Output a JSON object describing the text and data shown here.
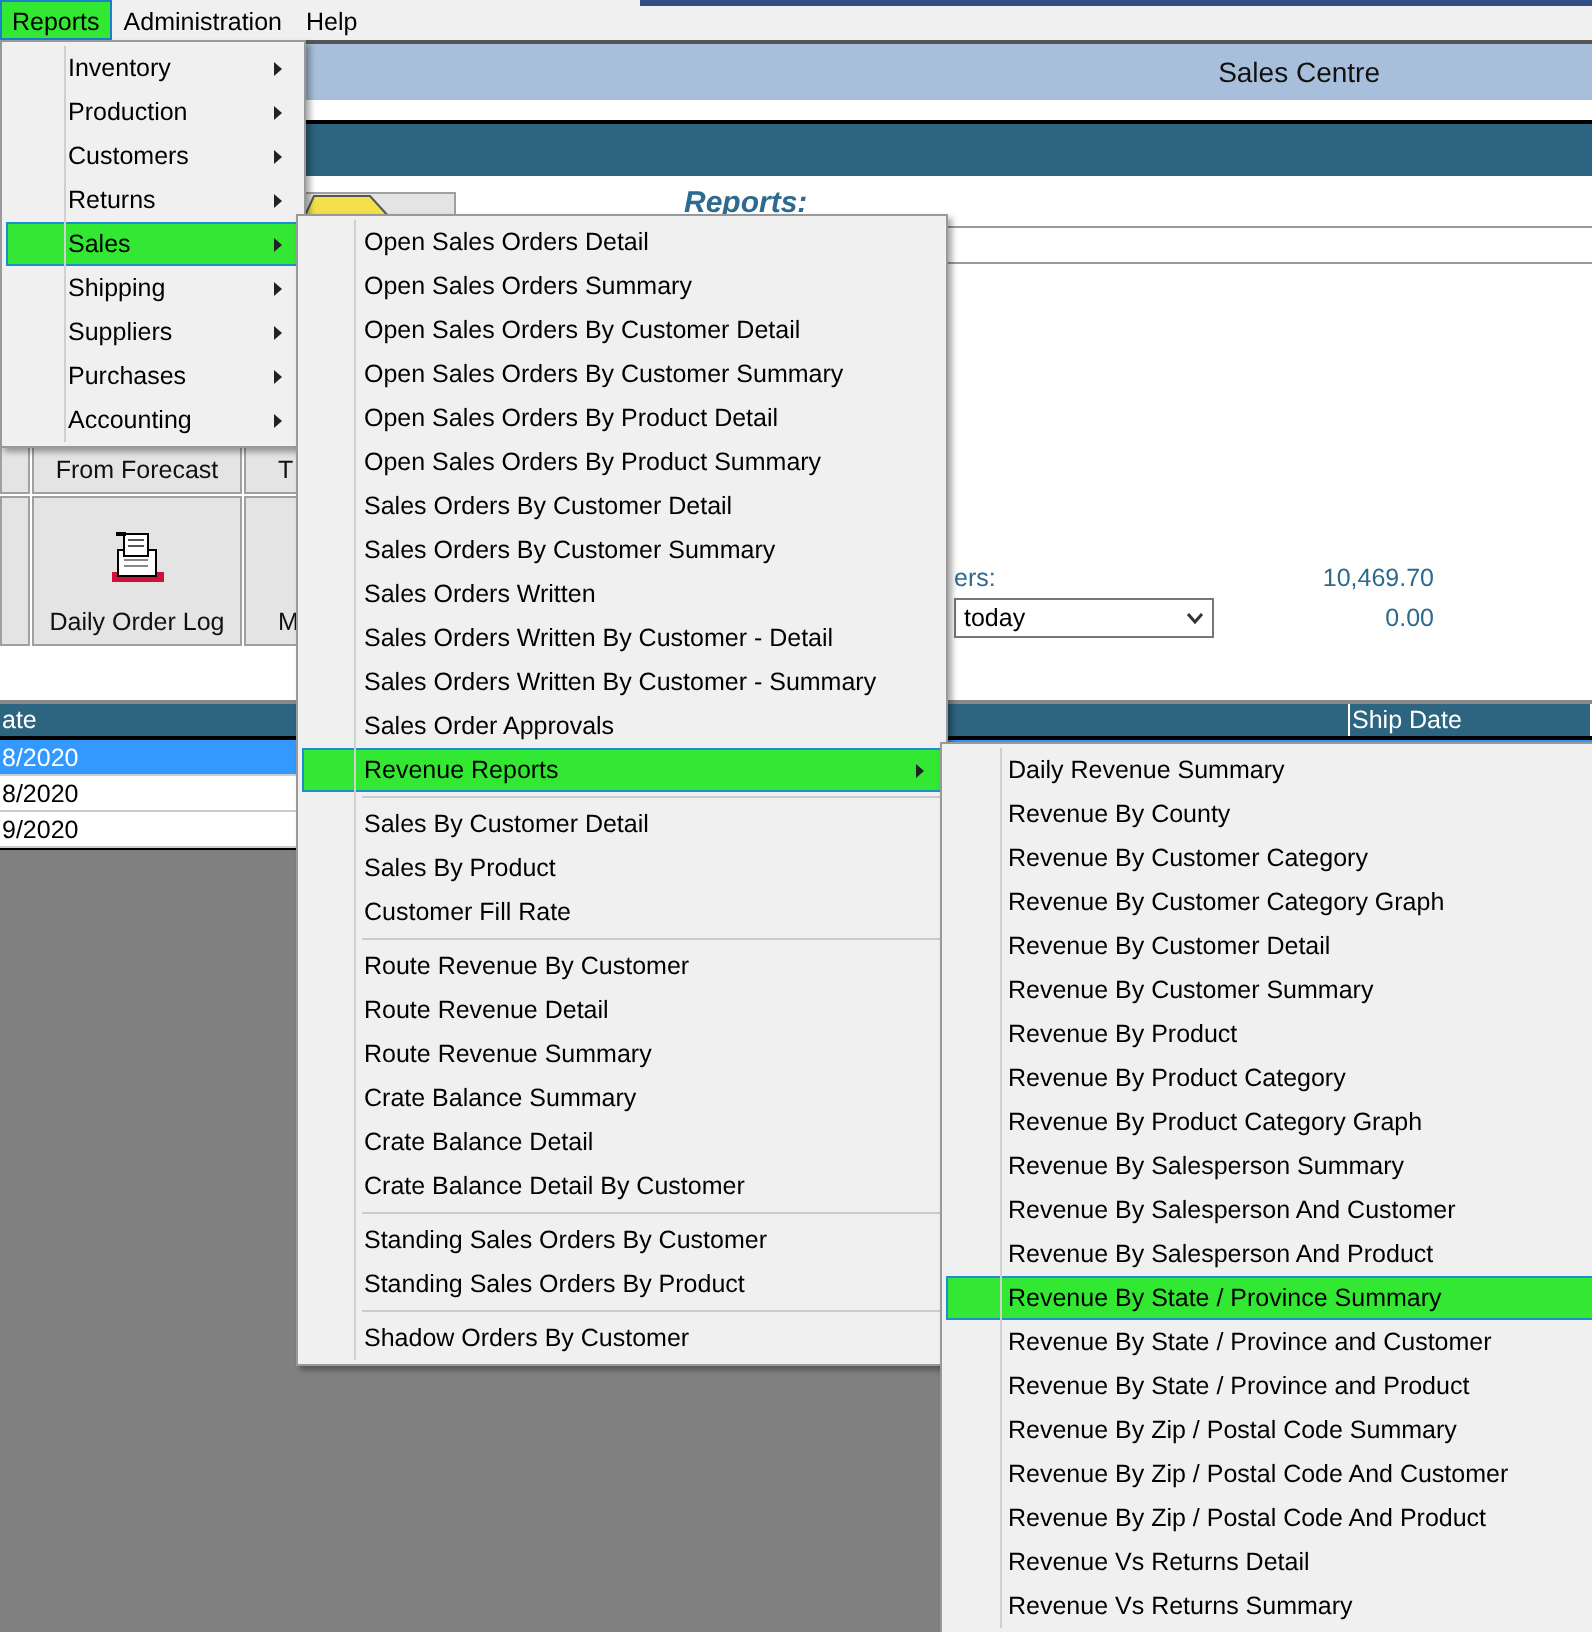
{
  "menu_bar": [
    {
      "label": "Reports",
      "selected": true
    },
    {
      "label": "Administration",
      "selected": false
    },
    {
      "label": "Help",
      "selected": false
    }
  ],
  "header": {
    "title": "Sales Centre"
  },
  "buttons": [
    {
      "label": "From Forecast"
    },
    {
      "label": "T"
    },
    {
      "label": "Daily Order Log"
    },
    {
      "label": "M"
    }
  ],
  "reports_heading": "Reports:",
  "totals": [
    {
      "label": "ers:",
      "value": "10,469.70"
    }
  ],
  "period": {
    "value": "today",
    "total": "0.00"
  },
  "table": {
    "columns": [
      "ate",
      "Ship Date"
    ],
    "rows": [
      {
        "cells": [
          "8/2020"
        ],
        "selected": true
      },
      {
        "cells": [
          "8/2020"
        ],
        "selected": false
      },
      {
        "cells": [
          "9/2020"
        ],
        "selected": false
      }
    ]
  },
  "menus": [
    {
      "items": [
        {
          "kind": "item",
          "label": "Inventory",
          "submenu": true,
          "selected": false
        },
        {
          "kind": "item",
          "label": "Production",
          "submenu": true,
          "selected": false
        },
        {
          "kind": "item",
          "label": "Customers",
          "submenu": true,
          "selected": false
        },
        {
          "kind": "item",
          "label": "Returns",
          "submenu": true,
          "selected": false
        },
        {
          "kind": "item",
          "label": "Sales",
          "submenu": true,
          "selected": true
        },
        {
          "kind": "item",
          "label": "Shipping",
          "submenu": true,
          "selected": false
        },
        {
          "kind": "item",
          "label": "Suppliers",
          "submenu": true,
          "selected": false
        },
        {
          "kind": "item",
          "label": "Purchases",
          "submenu": true,
          "selected": false
        },
        {
          "kind": "item",
          "label": "Accounting",
          "submenu": true,
          "selected": false
        }
      ]
    },
    {
      "items": [
        {
          "kind": "item",
          "label": "Open Sales Orders Detail",
          "submenu": false,
          "selected": false
        },
        {
          "kind": "item",
          "label": "Open Sales Orders Summary",
          "submenu": false,
          "selected": false
        },
        {
          "kind": "item",
          "label": "Open Sales Orders By Customer Detail",
          "submenu": false,
          "selected": false
        },
        {
          "kind": "item",
          "label": "Open Sales Orders By Customer Summary",
          "submenu": false,
          "selected": false
        },
        {
          "kind": "item",
          "label": "Open Sales Orders By Product Detail",
          "submenu": false,
          "selected": false
        },
        {
          "kind": "item",
          "label": "Open Sales Orders By Product Summary",
          "submenu": false,
          "selected": false
        },
        {
          "kind": "item",
          "label": "Sales Orders By Customer Detail",
          "submenu": false,
          "selected": false
        },
        {
          "kind": "item",
          "label": "Sales Orders By Customer Summary",
          "submenu": false,
          "selected": false
        },
        {
          "kind": "item",
          "label": "Sales Orders Written",
          "submenu": false,
          "selected": false
        },
        {
          "kind": "item",
          "label": "Sales Orders Written By Customer - Detail",
          "submenu": false,
          "selected": false
        },
        {
          "kind": "item",
          "label": "Sales Orders Written By Customer - Summary",
          "submenu": false,
          "selected": false
        },
        {
          "kind": "item",
          "label": "Sales Order Approvals",
          "submenu": false,
          "selected": false
        },
        {
          "kind": "item",
          "label": "Revenue Reports",
          "submenu": true,
          "selected": true
        },
        {
          "kind": "separator"
        },
        {
          "kind": "item",
          "label": "Sales By Customer Detail",
          "submenu": false,
          "selected": false
        },
        {
          "kind": "item",
          "label": "Sales By Product",
          "submenu": false,
          "selected": false
        },
        {
          "kind": "item",
          "label": "Customer Fill Rate",
          "submenu": false,
          "selected": false
        },
        {
          "kind": "separator"
        },
        {
          "kind": "item",
          "label": "Route Revenue By Customer",
          "submenu": false,
          "selected": false
        },
        {
          "kind": "item",
          "label": "Route Revenue Detail",
          "submenu": false,
          "selected": false
        },
        {
          "kind": "item",
          "label": "Route Revenue Summary",
          "submenu": false,
          "selected": false
        },
        {
          "kind": "item",
          "label": "Crate Balance Summary",
          "submenu": false,
          "selected": false
        },
        {
          "kind": "item",
          "label": "Crate Balance Detail",
          "submenu": false,
          "selected": false
        },
        {
          "kind": "item",
          "label": "Crate Balance Detail By Customer",
          "submenu": false,
          "selected": false
        },
        {
          "kind": "separator"
        },
        {
          "kind": "item",
          "label": "Standing Sales Orders By Customer",
          "submenu": false,
          "selected": false
        },
        {
          "kind": "item",
          "label": "Standing Sales Orders By Product",
          "submenu": false,
          "selected": false
        },
        {
          "kind": "separator"
        },
        {
          "kind": "item",
          "label": "Shadow Orders By Customer",
          "submenu": false,
          "selected": false
        }
      ]
    },
    {
      "items": [
        {
          "kind": "item",
          "label": "Daily Revenue Summary",
          "submenu": false,
          "selected": false
        },
        {
          "kind": "item",
          "label": "Revenue By County",
          "submenu": false,
          "selected": false
        },
        {
          "kind": "item",
          "label": "Revenue By Customer Category",
          "submenu": false,
          "selected": false
        },
        {
          "kind": "item",
          "label": "Revenue By Customer Category Graph",
          "submenu": false,
          "selected": false
        },
        {
          "kind": "item",
          "label": "Revenue By Customer Detail",
          "submenu": false,
          "selected": false
        },
        {
          "kind": "item",
          "label": "Revenue By Customer Summary",
          "submenu": false,
          "selected": false
        },
        {
          "kind": "item",
          "label": "Revenue By Product",
          "submenu": false,
          "selected": false
        },
        {
          "kind": "item",
          "label": "Revenue By Product Category",
          "submenu": false,
          "selected": false
        },
        {
          "kind": "item",
          "label": "Revenue By Product Category Graph",
          "submenu": false,
          "selected": false
        },
        {
          "kind": "item",
          "label": "Revenue By Salesperson Summary",
          "submenu": false,
          "selected": false
        },
        {
          "kind": "item",
          "label": "Revenue By Salesperson And Customer",
          "submenu": false,
          "selected": false
        },
        {
          "kind": "item",
          "label": "Revenue By Salesperson And Product",
          "submenu": false,
          "selected": false
        },
        {
          "kind": "item",
          "label": "Revenue By State / Province Summary",
          "submenu": false,
          "selected": true
        },
        {
          "kind": "item",
          "label": "Revenue By State / Province and Customer",
          "submenu": false,
          "selected": false
        },
        {
          "kind": "item",
          "label": "Revenue By State / Province and Product",
          "submenu": false,
          "selected": false
        },
        {
          "kind": "item",
          "label": "Revenue By Zip / Postal Code Summary",
          "submenu": false,
          "selected": false
        },
        {
          "kind": "item",
          "label": "Revenue By Zip / Postal Code And Customer",
          "submenu": false,
          "selected": false
        },
        {
          "kind": "item",
          "label": "Revenue By Zip / Postal Code And Product",
          "submenu": false,
          "selected": false
        },
        {
          "kind": "item",
          "label": "Revenue Vs Returns Detail",
          "submenu": false,
          "selected": false
        },
        {
          "kind": "item",
          "label": "Revenue Vs Returns Summary",
          "submenu": false,
          "selected": false
        }
      ]
    }
  ]
}
